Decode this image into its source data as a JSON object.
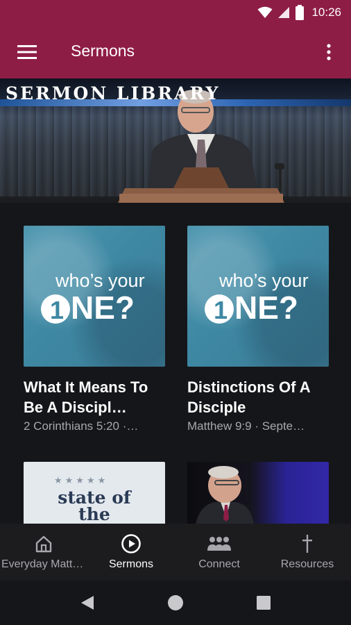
{
  "status_bar": {
    "time": "10:26"
  },
  "app_bar": {
    "title": "Sermons"
  },
  "hero": {
    "title": "Sermon Library"
  },
  "sermons": [
    {
      "title": "What It Means To Be A Discipl…",
      "subtitle": "2 Corinthians 5:20 ·…",
      "artwork": "who's your ONE?"
    },
    {
      "title": "Distinctions Of A Disciple",
      "subtitle": "Matthew 9:9 · Septe…",
      "artwork": "who's your ONE?"
    }
  ],
  "partial_cards": [
    {
      "artwork_line1": "state of",
      "artwork_line2": "the"
    },
    {
      "artwork": "speaker"
    }
  ],
  "bottom_nav": [
    {
      "label": "Everyday Matte…",
      "icon": "home-icon",
      "active": false
    },
    {
      "label": "Sermons",
      "icon": "play-circle-icon",
      "active": true
    },
    {
      "label": "Connect",
      "icon": "group-icon",
      "active": false
    },
    {
      "label": "Resources",
      "icon": "cross-icon",
      "active": false
    }
  ],
  "colors": {
    "brand": "#8e1d46",
    "background": "#151619",
    "nav_background": "#1c1c1f",
    "secondary_text": "#a8a8ac"
  }
}
